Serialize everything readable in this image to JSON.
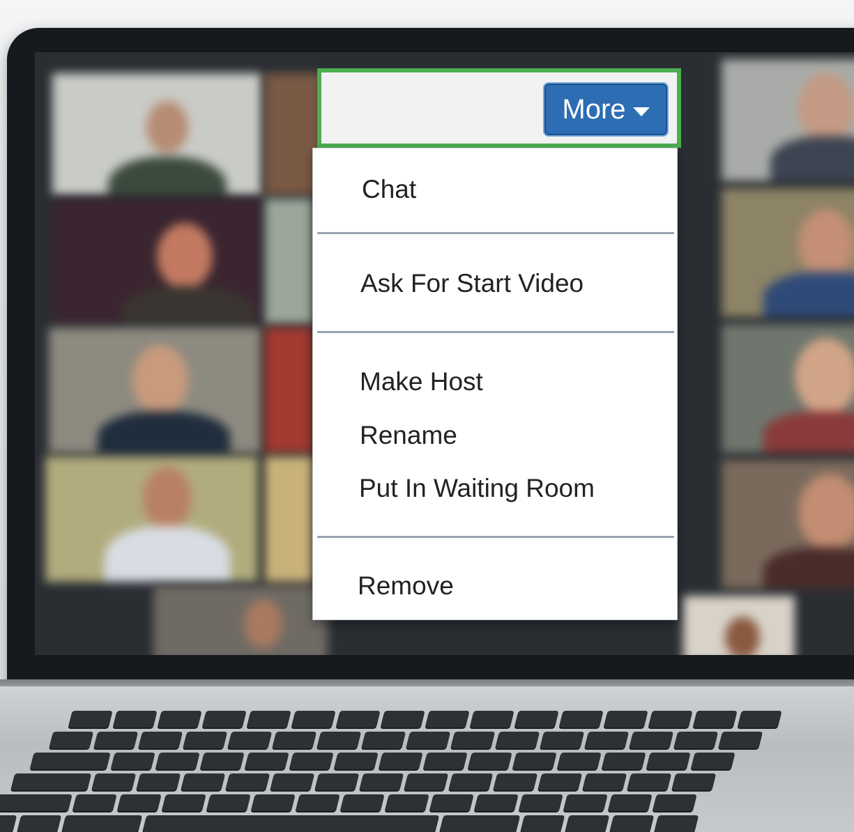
{
  "toolbar": {
    "more_label": "More",
    "more_icon": "caret-down-icon"
  },
  "menu": {
    "chat": "Chat",
    "ask_start_video": "Ask For Start Video",
    "make_host": "Make Host",
    "rename": "Rename",
    "put_in_waiting_room": "Put In Waiting Room",
    "remove": "Remove"
  },
  "colors": {
    "highlight_border": "#4caf50",
    "more_button": "#2d6db3",
    "menu_background": "#ffffff"
  }
}
